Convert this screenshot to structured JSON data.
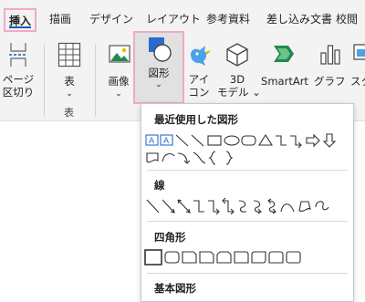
{
  "tabs": [
    {
      "label": "挿入",
      "active": true
    },
    {
      "label": "描画"
    },
    {
      "label": "デザイン"
    },
    {
      "label": "レイアウト"
    },
    {
      "label": "参考資料"
    },
    {
      "label": "差し込み文書"
    },
    {
      "label": "校閲"
    }
  ],
  "ribbon": {
    "page_break": [
      "ページ",
      "区切り"
    ],
    "table": "表",
    "table_group": "表",
    "picture": "画像",
    "shapes": "図形",
    "icons": [
      "アイ",
      "コン"
    ],
    "models3d": [
      "3D",
      "モデル"
    ],
    "smartart": "SmartArt",
    "chart": "グラフ",
    "screenshot": "スク"
  },
  "dropdown": {
    "recent_title": "最近使用した図形",
    "lines_title": "線",
    "rect_title": "四角形",
    "basic_title": "基本図形"
  },
  "colors": {
    "accent": "#185abd",
    "highlight": "#f2a8c7",
    "tab_bg": "#f3f3f3",
    "shapes_blue": "#2b6bd0",
    "smartart_green": "#1f8a4f",
    "icons_blue": "#1e90ff"
  }
}
